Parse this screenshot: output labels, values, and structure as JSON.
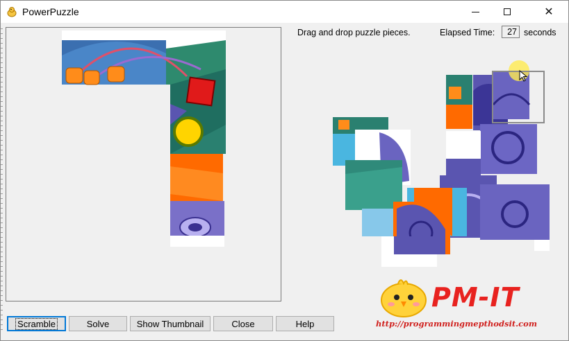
{
  "window": {
    "title": "PowerPuzzle",
    "app_icon": "puzzle-app-icon",
    "controls": {
      "minimize_icon": "minimize-icon",
      "maximize_icon": "maximize-icon",
      "close_icon": "close-icon",
      "close_glyph": "✕"
    }
  },
  "panel": {
    "instruction": "Drag and drop puzzle pieces.",
    "elapsed_label": "Elapsed Time:",
    "elapsed_value": "27",
    "elapsed_unit": "seconds"
  },
  "buttons": {
    "scramble": "Scramble",
    "solve": "Solve",
    "show_thumbnail": "Show Thumbnail",
    "close": "Close",
    "help": "Help"
  },
  "watermark": {
    "brand": "PM-IT",
    "url": "http://programmingmepthodsit.com",
    "mascot_icon": "chick-mascot-icon"
  },
  "colors": {
    "accent_button_border": "#0078d7",
    "watermark_red": "#e8221f",
    "puzzle_orange": "#ff6a00",
    "puzzle_purple": "#5a55b0",
    "puzzle_teal": "#2f8a7a",
    "puzzle_sky": "#4ab6e0",
    "cursor_highlight": "#ffeb50"
  }
}
